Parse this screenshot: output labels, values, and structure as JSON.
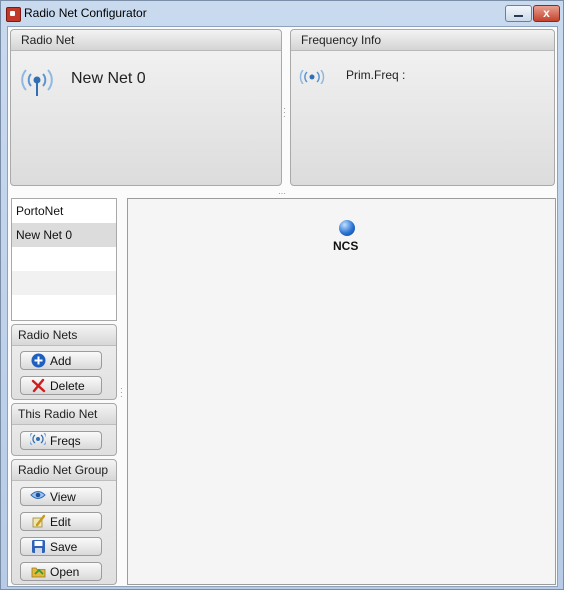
{
  "window": {
    "title": "Radio Net Configurator",
    "minimize_icon": "minimize-icon",
    "close_icon": "close-icon",
    "close_glyph": "x"
  },
  "radio_net_panel": {
    "header": "Radio Net",
    "net_name": "New Net 0",
    "icon": "radio-antenna-icon"
  },
  "frequency_panel": {
    "header": "Frequency Info",
    "prim_freq_label": "Prim.Freq  :",
    "icon": "radio-waves-icon"
  },
  "net_list": {
    "items": [
      {
        "label": "PortoNet"
      },
      {
        "label": "New Net 0",
        "selected": true
      },
      {
        "label": ""
      },
      {
        "label": ""
      },
      {
        "label": ""
      }
    ]
  },
  "canvas": {
    "node": {
      "label": "NCS",
      "icon": "node-sphere-icon"
    }
  },
  "groups": {
    "radio_nets": {
      "title": "Radio Nets",
      "add": {
        "label": "Add",
        "icon": "add-icon"
      },
      "delete": {
        "label": "Delete",
        "icon": "delete-icon"
      }
    },
    "this_radio_net": {
      "title": "This Radio Net",
      "freqs": {
        "label": "Freqs",
        "icon": "radio-waves-icon"
      }
    },
    "radio_net_group": {
      "title": "Radio Net Group",
      "view": {
        "label": "View",
        "icon": "eye-icon"
      },
      "edit": {
        "label": "Edit",
        "icon": "edit-icon"
      },
      "save": {
        "label": "Save",
        "icon": "save-icon"
      },
      "open": {
        "label": "Open",
        "icon": "open-folder-icon"
      }
    }
  },
  "colors": {
    "accent_blue": "#2f6fb3",
    "close_red": "#c2432d",
    "selected_row": "#dcdcdc"
  }
}
